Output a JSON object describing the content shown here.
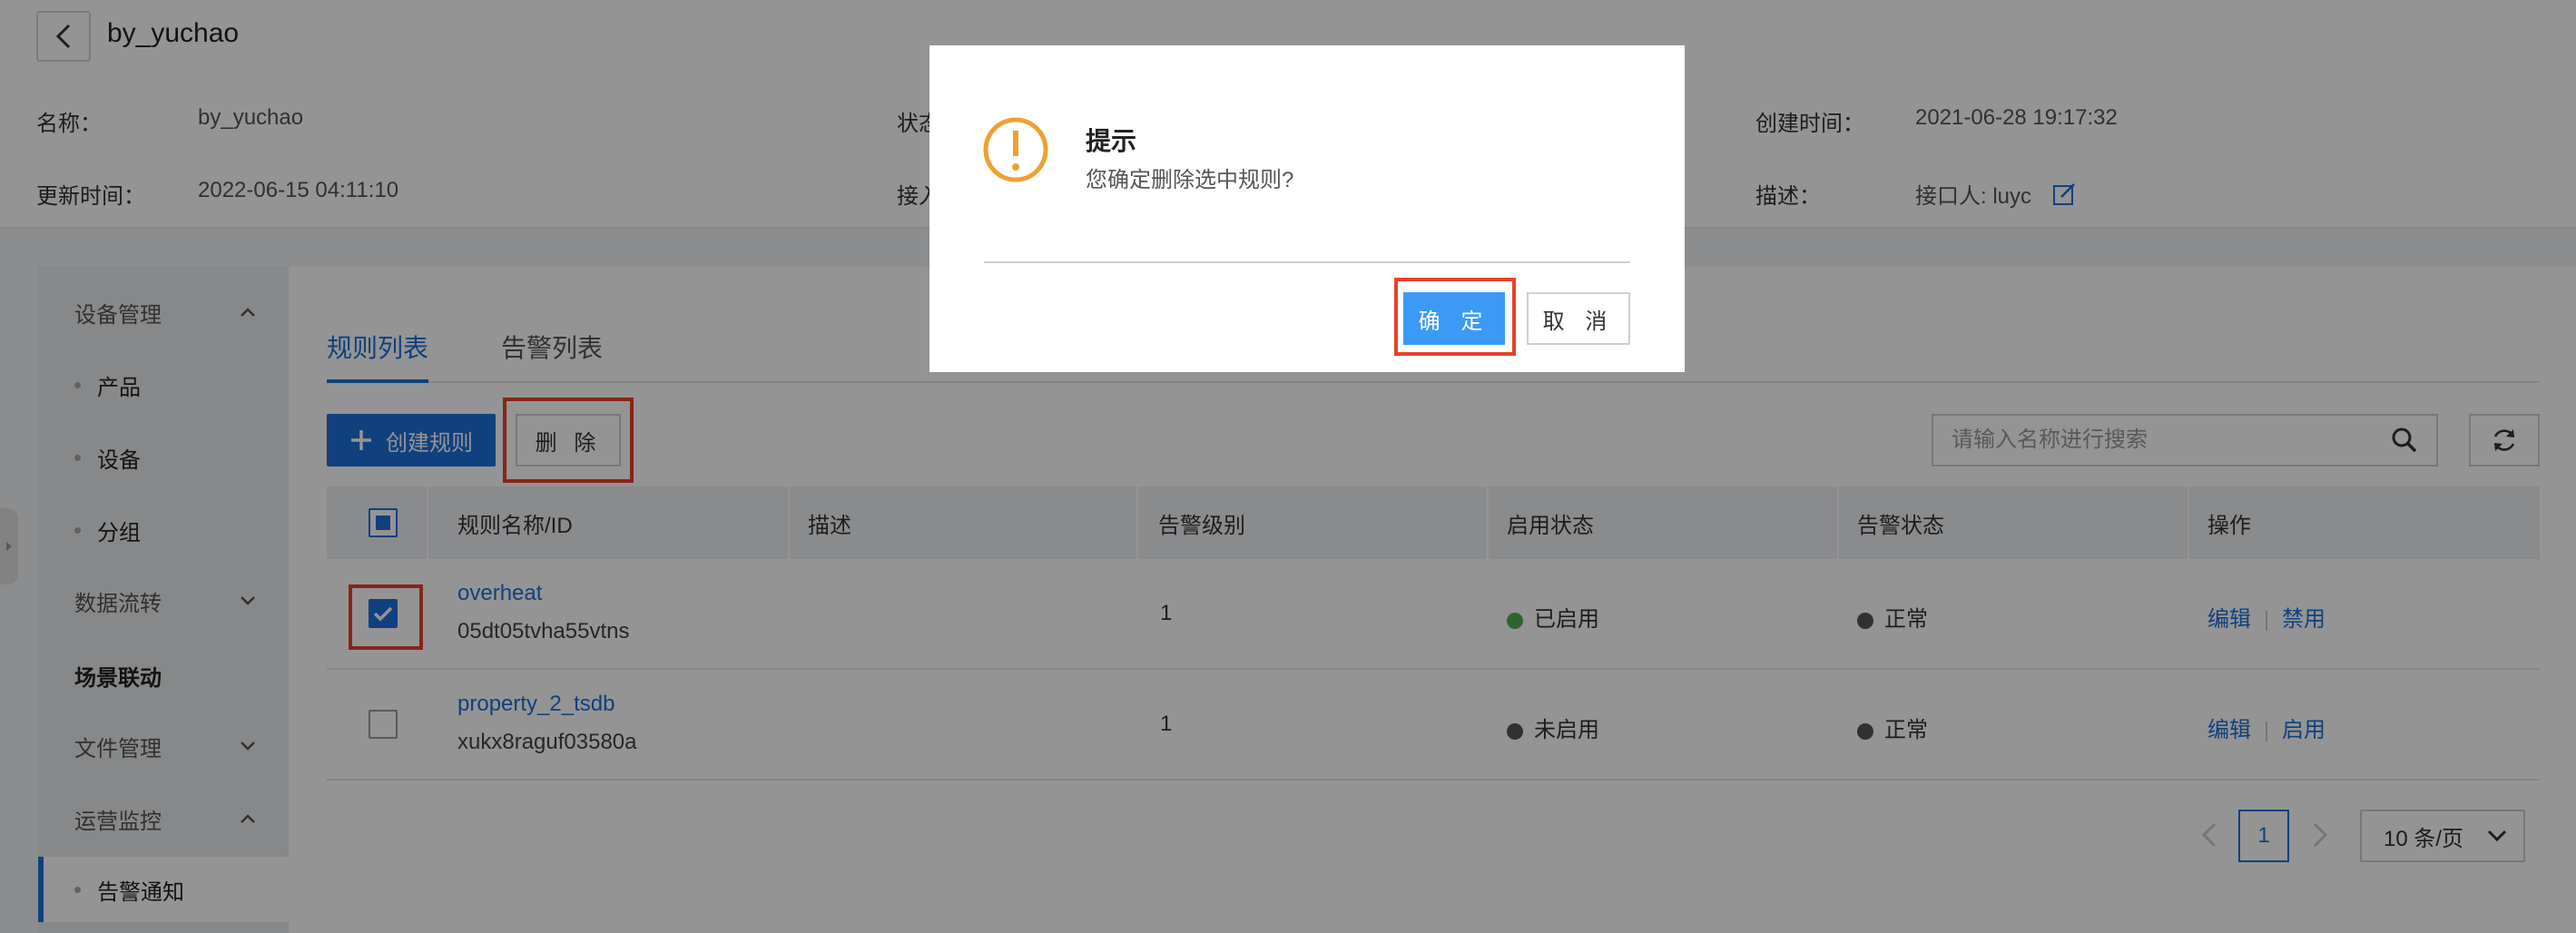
{
  "header": {
    "title": "by_yuchao",
    "info": {
      "name_label": "名称：",
      "name_value": "by_yuchao",
      "status_label": "状态",
      "created_label": "创建时间：",
      "created_value": "2021-06-28 19:17:32",
      "updated_label": "更新时间：",
      "updated_value": "2022-06-15 04:11:10",
      "access_label": "接入",
      "desc_label": "描述：",
      "desc_value": "接口人: luyc"
    }
  },
  "sidebar": {
    "device_mgmt": "设备管理",
    "product": "产品",
    "device": "设备",
    "group": "分组",
    "data_flow": "数据流转",
    "scene_linkage": "场景联动",
    "file_mgmt": "文件管理",
    "ops_monitor": "运营监控",
    "alert_notify": "告警通知"
  },
  "tabs": {
    "rules": "规则列表",
    "alerts": "告警列表"
  },
  "toolbar": {
    "create_label": "创建规则",
    "delete_label": "删 除",
    "search_placeholder": "请输入名称进行搜索"
  },
  "table": {
    "columns": [
      "规则名称/ID",
      "描述",
      "告警级别",
      "启用状态",
      "告警状态",
      "操作"
    ],
    "rows": [
      {
        "name": "overheat",
        "id": "05dt05tvha55vtns",
        "description": "",
        "level": "1",
        "enable_status": "已启用",
        "alert_status": "正常",
        "op_edit": "编辑",
        "op_toggle": "禁用",
        "checked": true
      },
      {
        "name": "property_2_tsdb",
        "id": "xukx8raguf03580a",
        "description": "",
        "level": "1",
        "enable_status": "未启用",
        "alert_status": "正常",
        "op_edit": "编辑",
        "op_toggle": "启用",
        "checked": false
      }
    ]
  },
  "pagination": {
    "current_page": "1",
    "page_size": "10 条/页"
  },
  "modal": {
    "title": "提示",
    "message": "您确定删除选中规则?",
    "ok_label": "确 定",
    "cancel_label": "取 消"
  },
  "colors": {
    "accent": "#1e6fd9",
    "highlight": "#e8412c",
    "warning": "#f0a030",
    "enabled": "#4caf50",
    "disabled": "#555555"
  }
}
